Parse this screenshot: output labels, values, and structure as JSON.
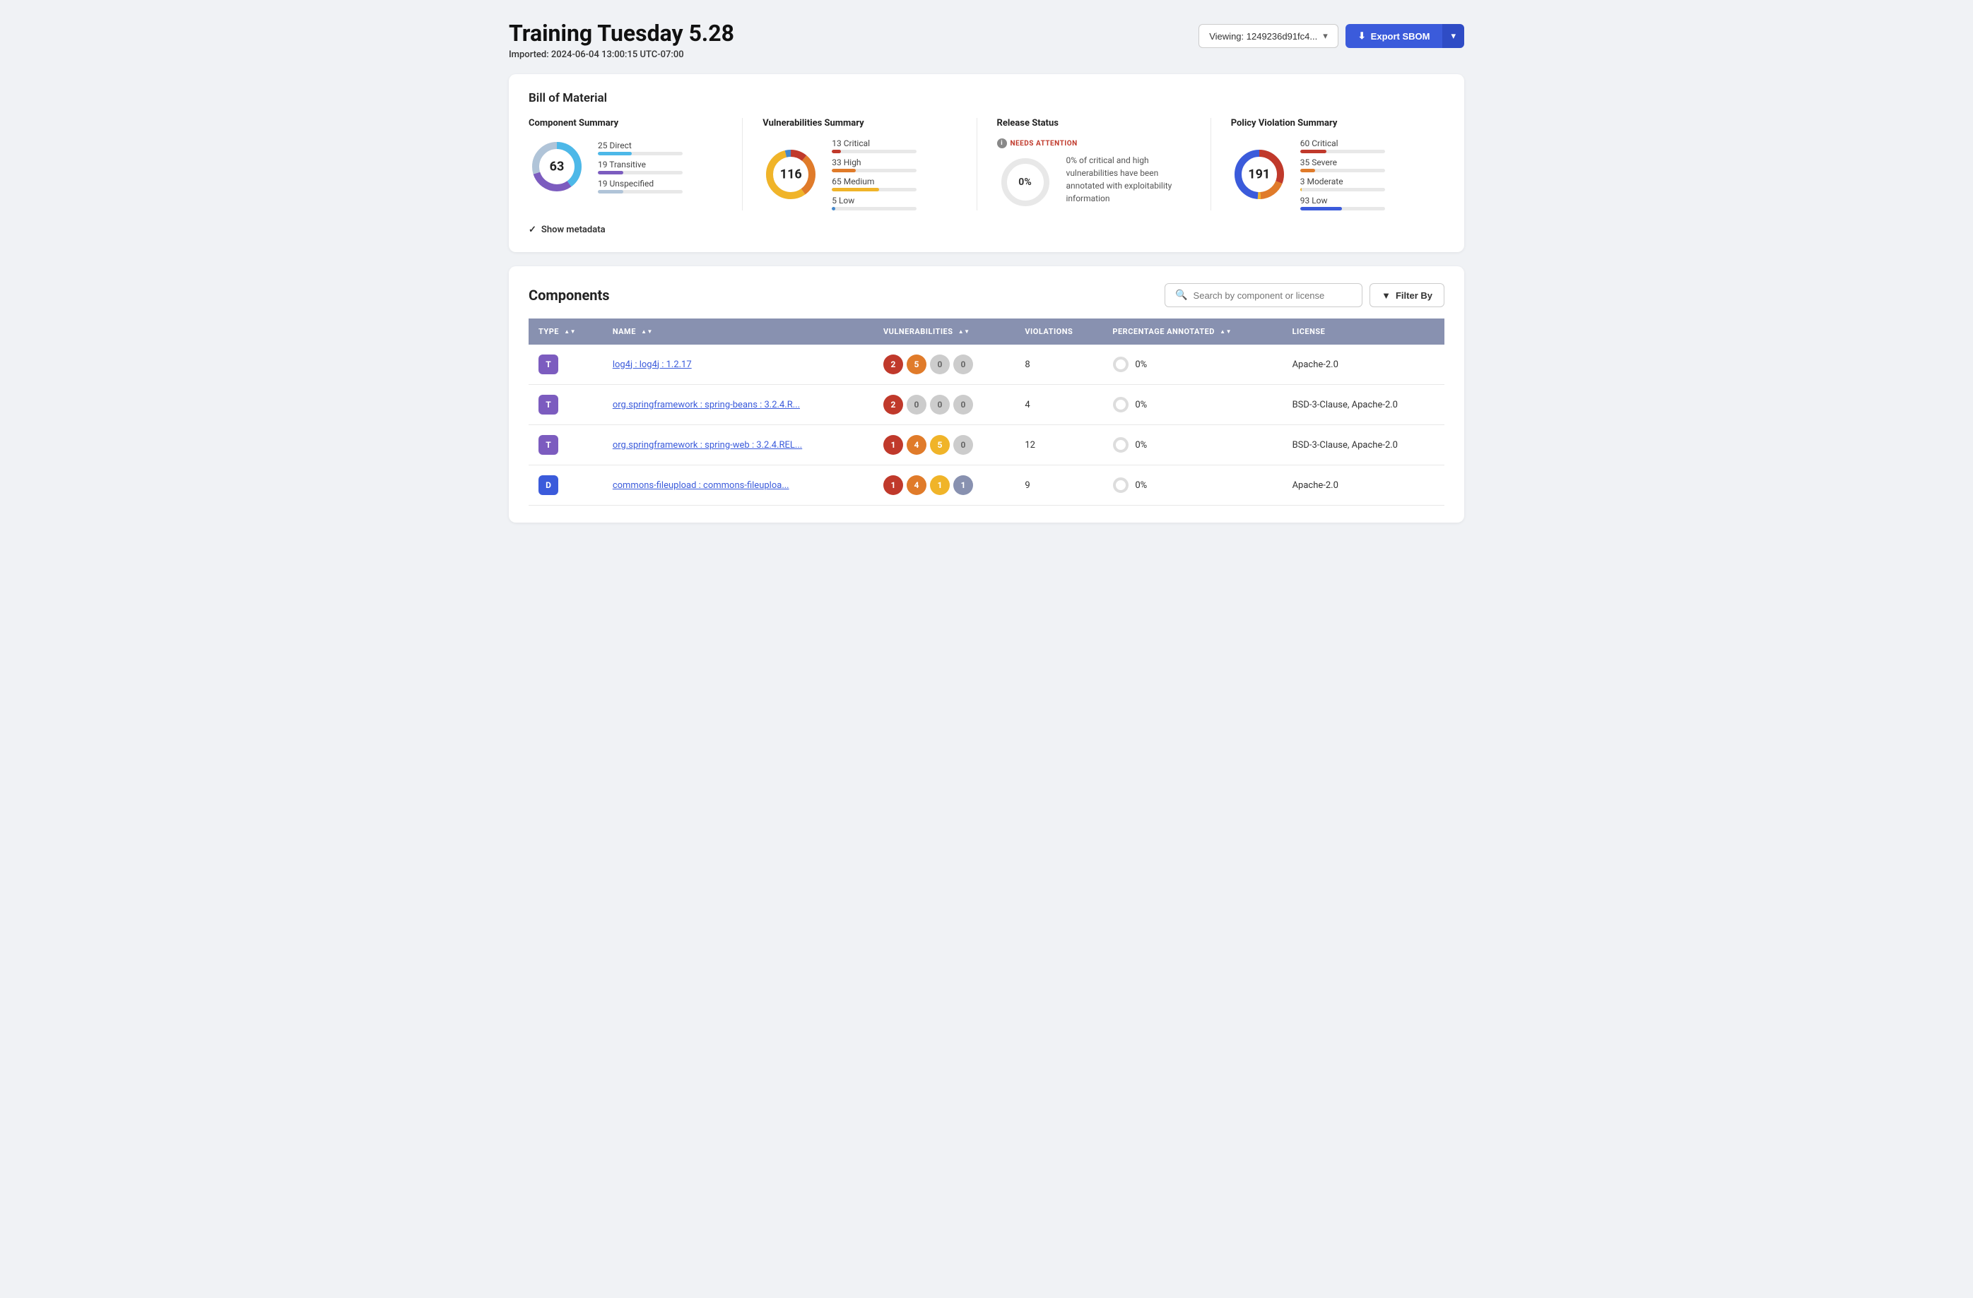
{
  "page": {
    "title": "Training Tuesday 5.28",
    "imported_label": "Imported:",
    "imported_date": "2024-06-04 13:00:15 UTC-07:00",
    "viewing_label": "Viewing: 1249236d91fc4...",
    "export_sbom_label": "Export SBOM"
  },
  "bom": {
    "title": "Bill of Material",
    "component_summary": {
      "title": "Component Summary",
      "total": "63",
      "stats": [
        {
          "label": "25 Direct",
          "value": 25,
          "max": 63,
          "bar_class": "bar-direct"
        },
        {
          "label": "19 Transitive",
          "value": 19,
          "max": 63,
          "bar_class": "bar-transitive"
        },
        {
          "label": "19 Unspecified",
          "value": 19,
          "max": 63,
          "bar_class": "bar-unspecified"
        }
      ],
      "donut_segments": [
        {
          "color": "#4db8e8",
          "pct": 40
        },
        {
          "color": "#7c5cbf",
          "pct": 30
        },
        {
          "color": "#b0c4d8",
          "pct": 30
        }
      ]
    },
    "vulnerabilities_summary": {
      "title": "Vulnerabilities Summary",
      "total": "116",
      "stats": [
        {
          "label": "13 Critical",
          "value": 13,
          "max": 116,
          "bar_class": "bar-critical"
        },
        {
          "label": "33 High",
          "value": 33,
          "max": 116,
          "bar_class": "bar-high"
        },
        {
          "label": "65 Medium",
          "value": 65,
          "max": 116,
          "bar_class": "bar-medium"
        },
        {
          "label": "5 Low",
          "value": 5,
          "max": 116,
          "bar_class": "bar-low"
        }
      ],
      "donut_segments": [
        {
          "color": "#c0392b",
          "pct": 11
        },
        {
          "color": "#e07b2a",
          "pct": 29
        },
        {
          "color": "#f0b429",
          "pct": 56
        },
        {
          "color": "#4488cc",
          "pct": 4
        }
      ]
    },
    "release_status": {
      "title": "Release Status",
      "badge": "NEEDS ATTENTION",
      "pct": "0%",
      "description": "0% of critical and high vulnerabilities have been annotated with exploitability information"
    },
    "policy_violation_summary": {
      "title": "Policy Violation Summary",
      "total": "191",
      "stats": [
        {
          "label": "60 Critical",
          "value": 60,
          "max": 191,
          "bar_class": "bar-p-critical"
        },
        {
          "label": "35 Severe",
          "value": 35,
          "max": 191,
          "bar_class": "bar-p-severe"
        },
        {
          "label": "3 Moderate",
          "value": 3,
          "max": 191,
          "bar_class": "bar-p-moderate"
        },
        {
          "label": "93 Low",
          "value": 93,
          "max": 191,
          "bar_class": "bar-p-low"
        }
      ],
      "donut_segments": [
        {
          "color": "#c0392b",
          "pct": 31
        },
        {
          "color": "#e07b2a",
          "pct": 18
        },
        {
          "color": "#f0b429",
          "pct": 2
        },
        {
          "color": "#3b5bdb",
          "pct": 49
        }
      ]
    },
    "show_metadata": "Show metadata"
  },
  "components": {
    "title": "Components",
    "search_placeholder": "Search by component or license",
    "filter_label": "Filter By",
    "table": {
      "headers": [
        {
          "label": "TYPE",
          "sortable": true
        },
        {
          "label": "NAME",
          "sortable": true
        },
        {
          "label": "VULNERABILITIES",
          "sortable": true
        },
        {
          "label": "VIOLATIONS",
          "sortable": false
        },
        {
          "label": "PERCENTAGE ANNOTATED",
          "sortable": true
        },
        {
          "label": "LICENSE",
          "sortable": false
        }
      ],
      "rows": [
        {
          "type": "T",
          "type_class": "type-t",
          "name": "log4j : log4j : 1.2.17",
          "vulns": [
            {
              "count": "2",
              "cls": "vb-critical"
            },
            {
              "count": "5",
              "cls": "vb-high"
            },
            {
              "count": "0",
              "cls": "vb-none"
            },
            {
              "count": "0",
              "cls": "vb-none"
            }
          ],
          "violations": "8",
          "annotated_pct": "0%",
          "license": "Apache-2.0"
        },
        {
          "type": "T",
          "type_class": "type-t",
          "name": "org.springframework : spring-beans : 3.2.4.R...",
          "vulns": [
            {
              "count": "2",
              "cls": "vb-critical"
            },
            {
              "count": "0",
              "cls": "vb-none"
            },
            {
              "count": "0",
              "cls": "vb-none"
            },
            {
              "count": "0",
              "cls": "vb-none"
            }
          ],
          "violations": "4",
          "annotated_pct": "0%",
          "license": "BSD-3-Clause, Apache-2.0"
        },
        {
          "type": "T",
          "type_class": "type-t",
          "name": "org.springframework : spring-web : 3.2.4.REL...",
          "vulns": [
            {
              "count": "1",
              "cls": "vb-critical"
            },
            {
              "count": "4",
              "cls": "vb-high"
            },
            {
              "count": "5",
              "cls": "vb-medium"
            },
            {
              "count": "0",
              "cls": "vb-none"
            }
          ],
          "violations": "12",
          "annotated_pct": "0%",
          "license": "BSD-3-Clause, Apache-2.0"
        },
        {
          "type": "D",
          "type_class": "type-d",
          "name": "commons-fileupload : commons-fileuploa...",
          "vulns": [
            {
              "count": "1",
              "cls": "vb-critical"
            },
            {
              "count": "4",
              "cls": "vb-high"
            },
            {
              "count": "1",
              "cls": "vb-medium"
            },
            {
              "count": "1",
              "cls": "vb-low"
            }
          ],
          "violations": "9",
          "annotated_pct": "0%",
          "license": "Apache-2.0"
        }
      ]
    }
  }
}
